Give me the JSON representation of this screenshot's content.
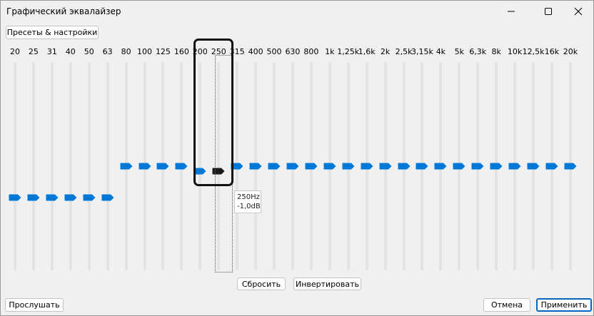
{
  "window": {
    "title": "Графический эквалайзер",
    "minimize_icon": "minimize-icon",
    "maximize_icon": "maximize-icon",
    "close_icon": "close-icon"
  },
  "presets_button": "Пресеты & настройки",
  "bands": [
    {
      "label": "20",
      "level": 0.35
    },
    {
      "label": "25",
      "level": 0.35
    },
    {
      "label": "31",
      "level": 0.35
    },
    {
      "label": "40",
      "level": 0.35
    },
    {
      "label": "50",
      "level": 0.35
    },
    {
      "label": "63",
      "level": 0.35
    },
    {
      "label": "80",
      "level": 0.5
    },
    {
      "label": "100",
      "level": 0.5
    },
    {
      "label": "125",
      "level": 0.5
    },
    {
      "label": "160",
      "level": 0.5
    },
    {
      "label": "200",
      "level": 0.475
    },
    {
      "label": "250",
      "level": 0.475,
      "selected": true
    },
    {
      "label": "315",
      "level": 0.5
    },
    {
      "label": "400",
      "level": 0.5
    },
    {
      "label": "500",
      "level": 0.5
    },
    {
      "label": "630",
      "level": 0.5
    },
    {
      "label": "800",
      "level": 0.5
    },
    {
      "label": "1k",
      "level": 0.5
    },
    {
      "label": "1,25k",
      "level": 0.5
    },
    {
      "label": "1,6k",
      "level": 0.5
    },
    {
      "label": "2k",
      "level": 0.5
    },
    {
      "label": "2,5k",
      "level": 0.5
    },
    {
      "label": "3,15k",
      "level": 0.5
    },
    {
      "label": "4k",
      "level": 0.5
    },
    {
      "label": "5k",
      "level": 0.5
    },
    {
      "label": "6,3k",
      "level": 0.5
    },
    {
      "label": "8k",
      "level": 0.5
    },
    {
      "label": "10k",
      "level": 0.5
    },
    {
      "label": "12,5k",
      "level": 0.5
    },
    {
      "label": "16k",
      "level": 0.5
    },
    {
      "label": "20k",
      "level": 0.5
    }
  ],
  "tooltip": {
    "freq": "250Hz",
    "gain": "-1,0dB"
  },
  "buttons": {
    "reset": "Сбросить",
    "invert": "Инвертировать",
    "listen": "Прослушать",
    "cancel": "Отмена",
    "apply": "Применить"
  },
  "colors": {
    "thumb": "#0078d7",
    "thumb_selected": "#1a1a1a",
    "accent": "#0067c0"
  }
}
